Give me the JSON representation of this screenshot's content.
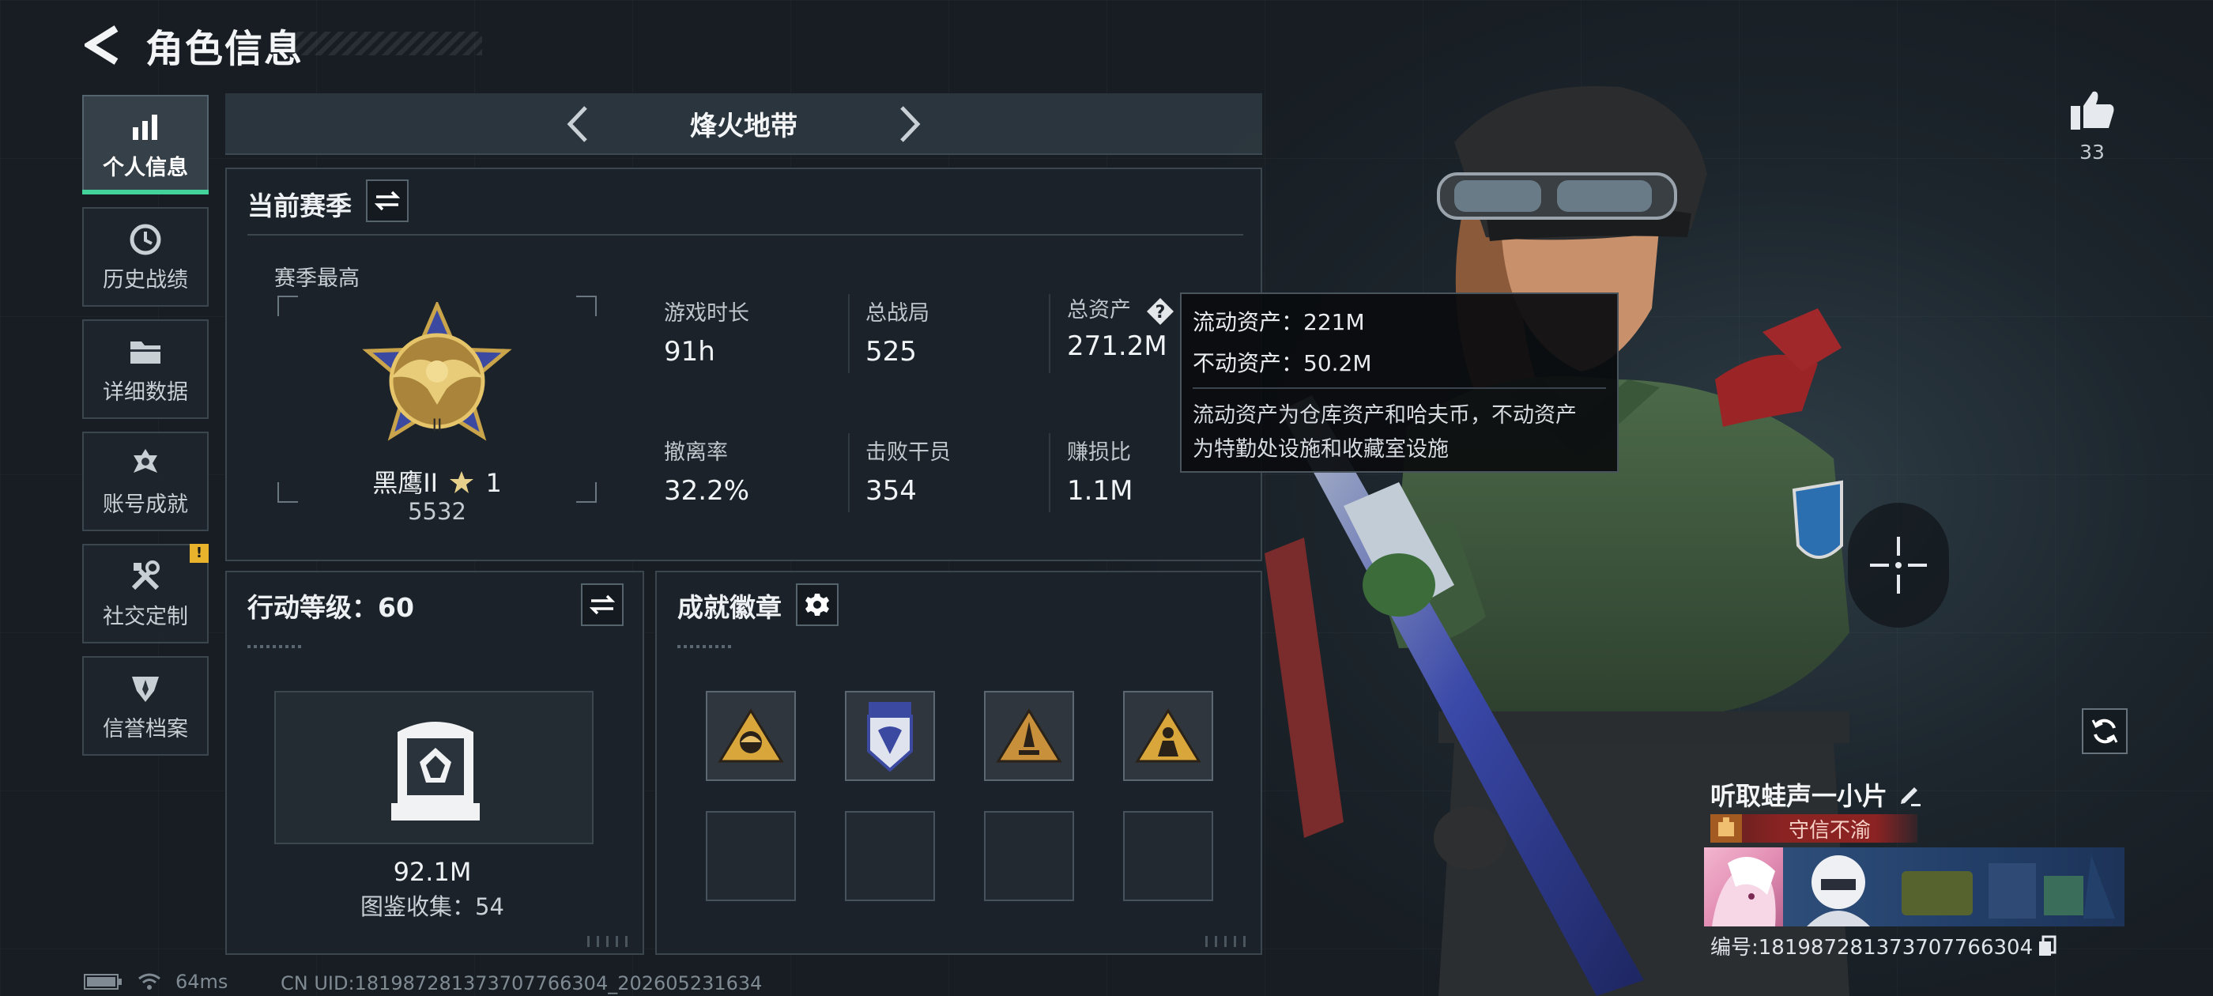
{
  "header": {
    "title": "角色信息"
  },
  "nav": {
    "items": [
      {
        "label": "个人信息",
        "icon": "bar-chart-icon",
        "active": true
      },
      {
        "label": "历史战绩",
        "icon": "history-clock-icon"
      },
      {
        "label": "详细数据",
        "icon": "folder-icon"
      },
      {
        "label": "账号成就",
        "icon": "achievement-icon"
      },
      {
        "label": "社交定制",
        "icon": "tools-icon",
        "alert": "!"
      },
      {
        "label": "信誉档案",
        "icon": "shield-badge-icon"
      }
    ]
  },
  "mode": {
    "title": "烽火地带"
  },
  "season": {
    "title": "当前赛季",
    "best_label": "赛季最高",
    "rank_name": "黑鹰II",
    "rank_stars": "1",
    "rank_score": "5532",
    "stats": [
      {
        "label": "游戏时长",
        "value": "91h"
      },
      {
        "label": "总战局",
        "value": "525"
      },
      {
        "label": "总资产",
        "value": "271.2M"
      },
      {
        "label": "撤离率",
        "value": "32.2%"
      },
      {
        "label": "击败干员",
        "value": "354"
      },
      {
        "label": "赚损比",
        "value": "1.1M"
      }
    ]
  },
  "tooltip": {
    "liquid": "流动资产：221M",
    "fixed": "不动资产：50.2M",
    "desc_line1": "流动资产为仓库资产和哈夫币，不动资产",
    "desc_line2": "为特勤处设施和收藏室设施"
  },
  "action": {
    "title": "行动等级：60",
    "value": "92.1M",
    "collection": "图鉴收集：54"
  },
  "badges": {
    "title": "成就徽章",
    "slots": [
      {
        "icon": "gold-triangle-emblem-icon",
        "filled": true
      },
      {
        "icon": "blue-wing-badge-icon",
        "filled": true
      },
      {
        "icon": "rocket-triangle-emblem-icon",
        "filled": true
      },
      {
        "icon": "operator-triangle-emblem-icon",
        "filled": true
      },
      {
        "filled": false
      },
      {
        "filled": false
      },
      {
        "filled": false
      },
      {
        "filled": false
      }
    ]
  },
  "profile": {
    "likes": "33",
    "nickname": "听取蛙声一小片",
    "title_badge": "守信不渝",
    "player_id": "编号:1819872813737077663​04"
  },
  "status": {
    "ping": "64ms",
    "uid": "CN UID:1819872813737077663​04_202605231634"
  },
  "colors": {
    "accent": "#43d39a",
    "alert": "#e9b42b",
    "title_red": "#8b2323"
  }
}
